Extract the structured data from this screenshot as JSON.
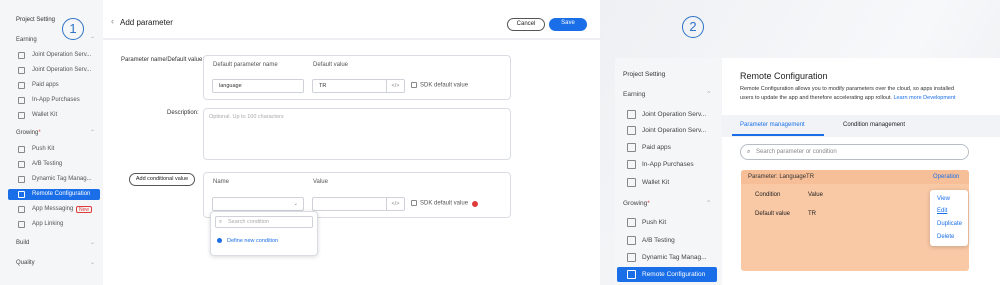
{
  "p1": {
    "marker": "1",
    "sidebar": {
      "title": "Project Setting",
      "earning": "Earning",
      "earning_items": [
        "Joint Operation Serv...",
        "Joint Operation Serv...",
        "Paid apps",
        "In-App Purchases",
        "Wallet Kit"
      ],
      "growing": "Growing",
      "growing_items": [
        "Push Kit",
        "A/B Testing",
        "Dynamic Tag Manag...",
        "Remote Configuration",
        "App Messaging",
        "App Linking"
      ],
      "new_badge": "New",
      "build": "Build",
      "quality": "Quality"
    },
    "header": {
      "back": "‹",
      "title": "Add parameter",
      "cancel": "Cancel",
      "save": "Save"
    },
    "form": {
      "name_default_label": "Parameter name/Default value:",
      "col_name": "Default parameter name",
      "col_value": "Default value",
      "name_value": "language",
      "default_value": "TR",
      "code_icon": "</>",
      "sdk_default": "SDK default value",
      "description_label": "Description:",
      "description_placeholder": "Optional. Up to 100 characters",
      "add_conditional": "Add conditional value",
      "cond_name_col": "Name",
      "cond_value_col": "Value",
      "search_placeholder": "Search condition",
      "define_new": "Define new condition"
    }
  },
  "p2": {
    "marker": "2",
    "sidebar": {
      "title": "Project Setting",
      "earning": "Earning",
      "earning_items": [
        "Joint Operation Serv...",
        "Joint Operation Serv...",
        "Paid apps",
        "In-App Purchases",
        "Wallet Kit"
      ],
      "growing": "Growing",
      "growing_items": [
        "Push Kit",
        "A/B Testing",
        "Dynamic Tag Manag...",
        "Remote Configuration"
      ]
    },
    "main": {
      "title": "Remote Configuration",
      "desc_line1": "Remote Configuration allows you to modify parameters over the cloud, so apps installed",
      "desc_line2": "users to update the app and therefore accelerating app rollout.",
      "learn_more": "Learn more",
      "development": "Development",
      "tabs": [
        "Parameter management",
        "Condition management"
      ],
      "search_placeholder": "Search parameter or condition",
      "param_header": "Parameter: LanguageTR",
      "operation": "Operation",
      "condition_col": "Condition",
      "value_col": "Value",
      "row_label": "Default value",
      "row_value": "TR",
      "menu": [
        "View",
        "Edit",
        "Duplicate",
        "Delete"
      ]
    }
  },
  "colors": {
    "accent": "#1a6fe8",
    "highlight": "#f9c8a5",
    "badge": "#e03b3b"
  }
}
